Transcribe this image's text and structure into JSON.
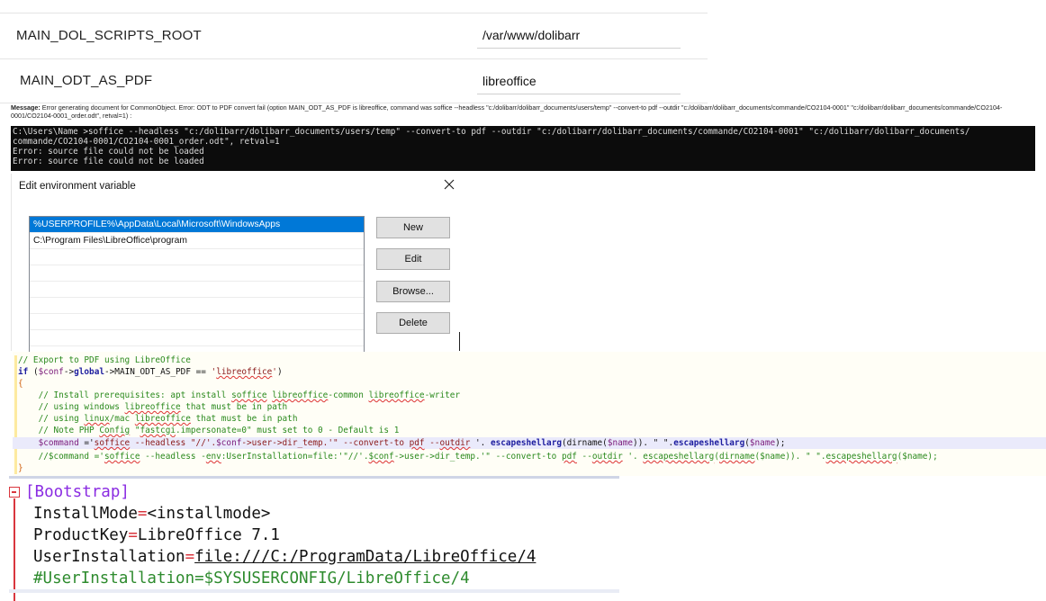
{
  "settings": {
    "rows": [
      {
        "key": "MAIN_DOL_SCRIPTS_ROOT",
        "value": "/var/www/dolibarr"
      },
      {
        "key": "MAIN_ODT_AS_PDF",
        "value": "libreoffice"
      }
    ]
  },
  "message": {
    "label": "Message:",
    "text": "Error generating document for CommonObject. Error: ODT to PDF convert fail (option MAIN_ODT_AS_PDF is libreoffice, command was soffice --headless \"c:/dolibarr/dolibarr_documents/users/temp\" --convert-to pdf --outdir \"c:/dolibarr/dolibarr_documents/commande/CO2104-0001\" \"c:/dolibarr/dolibarr_documents/commande/CO2104-0001/CO2104-0001_order.odt\", retval=1) :"
  },
  "console": {
    "lines": [
      "C:\\Users\\Name >soffice --headless \"c:/dolibarr/dolibarr_documents/users/temp\" --convert-to pdf --outdir \"c:/dolibarr/dolibarr_documents/commande/CO2104-0001\" \"c:/dolibarr/dolibarr_documents/",
      "commande/CO2104-0001/CO2104-0001_order.odt\", retval=1",
      "Error: source file could not be loaded",
      "Error: source file could not be loaded"
    ]
  },
  "dialog": {
    "title": "Edit environment variable",
    "close_icon": "close-icon",
    "items": [
      "%USERPROFILE%\\AppData\\Local\\Microsoft\\WindowsApps",
      "C:\\Program Files\\LibreOffice\\program",
      "",
      "",
      "",
      "",
      "",
      "",
      ""
    ],
    "buttons": {
      "new": "New",
      "edit": "Edit",
      "browse": "Browse...",
      "delete": "Delete"
    },
    "selected_color": "#0078d7"
  },
  "php": {
    "c1": "// Export to PDF using LibreOffice",
    "if_kw": "if",
    "if_open": " (",
    "if_conf": "$conf",
    "if_arrow1": "->",
    "if_global": "global",
    "if_arrow2": "->",
    "if_const": "MAIN_ODT_AS_PDF",
    "if_eq": " == ",
    "if_str_a": "'",
    "if_str_b": "libreoffice",
    "if_str_c": "'",
    "if_close": ")",
    "brace_open": "{",
    "c2a": "    // Install prerequisites: apt install ",
    "c2b": "soffice",
    "c2c": " ",
    "c2d": "libreoffice",
    "c2e": "-common ",
    "c2f": "libreoffice",
    "c2g": "-writer",
    "c3a": "    // using windows ",
    "c3b": "libreoffice",
    "c3c": " that must be in path",
    "c4a": "    // using ",
    "c4b": "linux",
    "c4c": "/mac ",
    "c4d": "libreoffice",
    "c4e": " that must be in path",
    "c5a": "    // Note PHP ",
    "c5b": "Config",
    "c5c": " \"",
    "c5d": "fastcgi",
    "c5e": ".impersonate=0\" must set to 0 - Default is 1",
    "l6a": "    ",
    "l6b": "$command",
    "l6c": " ='",
    "l6d": "soffice",
    "l6e": " --headless \"//'.",
    "l6f": "$conf",
    "l6g": "->user->dir_temp.'\" --convert-to ",
    "l6h": "pdf",
    "l6i": " --",
    "l6j": "outdir",
    "l6k": " '. ",
    "l6l": "escapeshellarg",
    "l6m": "(dirname(",
    "l6n": "$name",
    "l6o": ")). \" \".",
    "l6p": "escapeshellarg",
    "l6q": "(",
    "l6r": "$name",
    "l6s": ");",
    "l7a": "    //$command ='",
    "l7b": "soffice",
    "l7c": " --headless -",
    "l7d": "env",
    "l7e": ":UserInstallation=file:'\"//'.",
    "l7f": "$conf",
    "l7g": "->user->dir_temp.'\" --convert-to ",
    "l7h": "pdf",
    "l7i": " --",
    "l7j": "outdir",
    "l7k": " '. ",
    "l7l": "escapeshellarg",
    "l7m": "(",
    "l7n": "dirname",
    "l7o": "($name)). \" \".",
    "l7p": "escapeshellarg",
    "l7q": "($name);",
    "brace_close": "}"
  },
  "ini": {
    "section": "[Bootstrap]",
    "l1_key": "InstallMode",
    "l1_eq": "=",
    "l1_val": "<installmode>",
    "l2_key": "ProductKey",
    "l2_eq": "=",
    "l2_val": "LibreOffice 7.1",
    "l3_key": "UserInstallation",
    "l3_eq": "=",
    "l3_val": "file:///C:/ProgramData/LibreOffice/4",
    "l4": "#UserInstallation=$SYSUSERCONFIG/LibreOffice/4"
  }
}
